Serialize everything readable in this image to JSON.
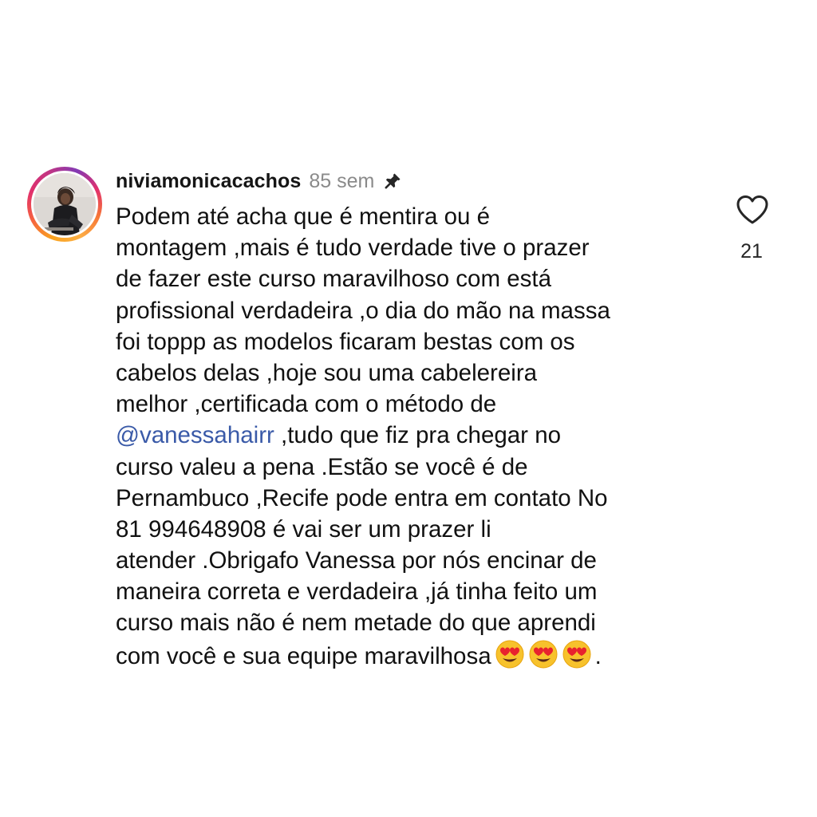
{
  "comment": {
    "username": "niviamonicacachos",
    "time": "85 sem",
    "lines": [
      "Podem até acha que é mentira ou é",
      "montagem ,mais é tudo verdade tive o prazer",
      "de fazer este curso maravilhoso com está",
      "profissional verdadeira ,o dia do mão na massa",
      "foi toppp  as modelos ficaram bestas com os",
      "cabelos delas ,hoje sou uma cabelereira",
      "melhor ,certificada  com o método de"
    ],
    "mention": "@vanessahairr",
    "mention_rest": " ,tudo que fiz pra chegar no",
    "lines_after": [
      "curso valeu a pena .Estão  se você é de",
      "Pernambuco ,Recife pode entra em contato No",
      "81 994648908 é vai ser um prazer li",
      "atender .Obrigafo Vanessa por nós  encinar  de",
      "maneira correta  e  verdadeira ,já tinha feito um",
      "curso mais não é nem metade do que aprendi"
    ],
    "last_line": "com você e sua equipe maravilhosa",
    "last_line_end": ".",
    "emojis": [
      "heart-eyes-emoji",
      "heart-eyes-emoji",
      "heart-eyes-emoji"
    ],
    "like_count": "21"
  },
  "icons": {
    "avatar": "profile-photo",
    "pin": "pin-icon",
    "like": "heart-outline-icon"
  },
  "colors": {
    "mention": "#3a5aa8",
    "time": "#8a8a8a",
    "ring": [
      "#f9a21f",
      "#e1306c",
      "#833ab4"
    ]
  }
}
